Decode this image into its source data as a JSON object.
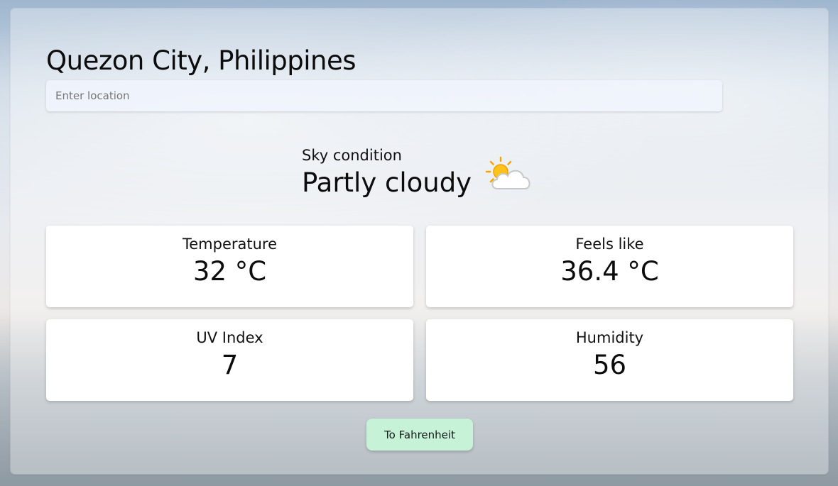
{
  "location": {
    "title": "Quezon City, Philippines",
    "search_placeholder": "Enter location"
  },
  "sky": {
    "label": "Sky condition",
    "value": "Partly cloudy",
    "icon": "partly-cloudy-icon"
  },
  "stats": {
    "temperature": {
      "label": "Temperature",
      "value": "32 °C"
    },
    "feels_like": {
      "label": "Feels like",
      "value": "36.4 °C"
    },
    "uv_index": {
      "label": "UV Index",
      "value": "7"
    },
    "humidity": {
      "label": "Humidity",
      "value": "56"
    }
  },
  "actions": {
    "convert_label": "To Fahrenheit"
  },
  "colors": {
    "convert_button": "#c6f2d8",
    "card_background": "#ffffff"
  }
}
